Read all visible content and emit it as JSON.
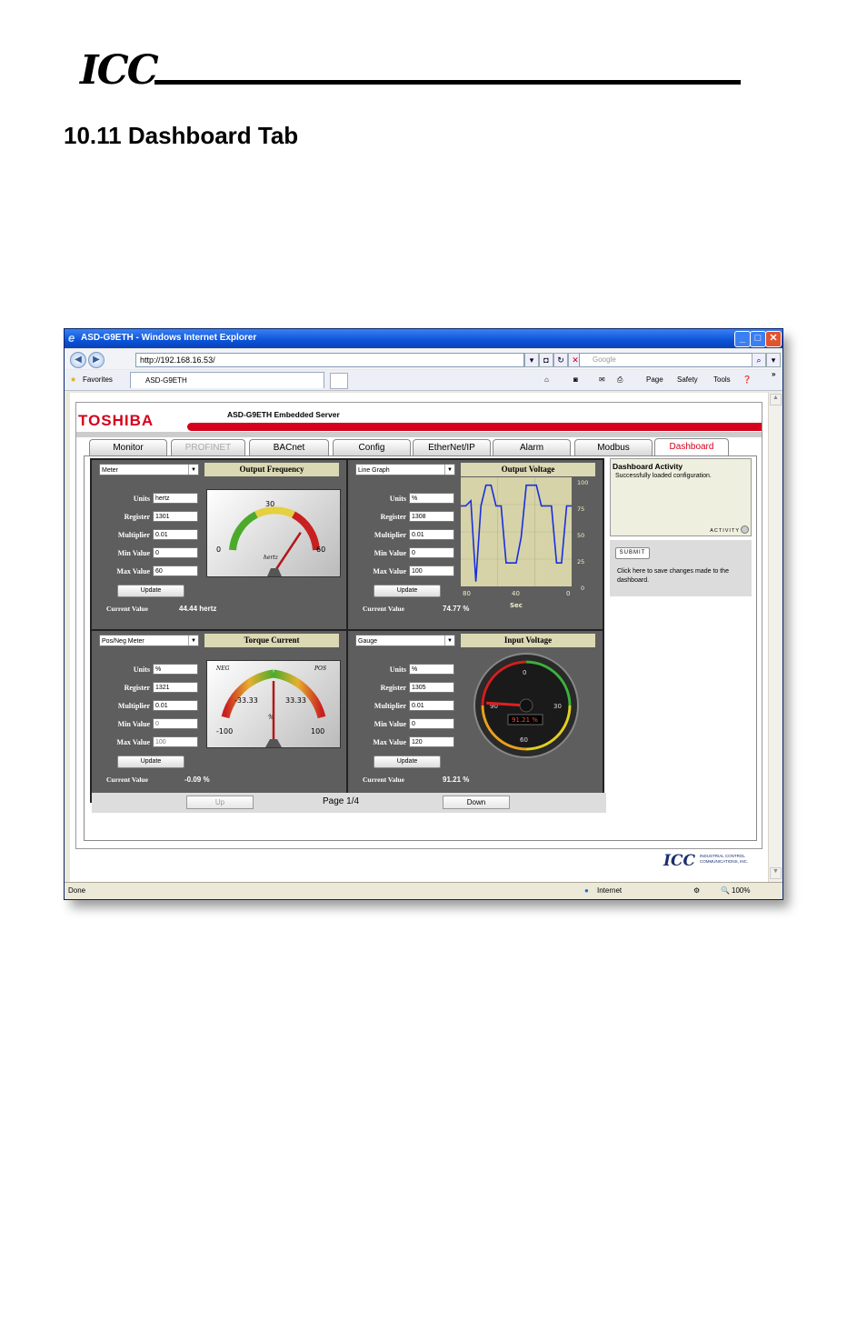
{
  "doc_header": {
    "logo": "ICC"
  },
  "section": {
    "title": "10.11   Dashboard Tab"
  },
  "window": {
    "title": "ASD-G9ETH - Windows Internet Explorer"
  },
  "browser": {
    "address": "http://192.168.16.53/",
    "search_placeholder": "Google",
    "favorites": "Favorites",
    "tab_title": "ASD-G9ETH",
    "menu": {
      "page": "Page",
      "safety": "Safety",
      "tools": "Tools"
    },
    "status_left": "Done",
    "status_zone": "Internet",
    "zoom": "100%"
  },
  "app": {
    "brand": "TOSHIBA",
    "server_title": "ASD-G9ETH Embedded Server",
    "tabs": [
      {
        "label": "Monitor",
        "state": "normal"
      },
      {
        "label": "PROFINET",
        "state": "disabled"
      },
      {
        "label": "BACnet",
        "state": "normal"
      },
      {
        "label": "Config",
        "state": "normal"
      },
      {
        "label": "EtherNet/IP",
        "state": "normal"
      },
      {
        "label": "Alarm",
        "state": "normal"
      },
      {
        "label": "Modbus",
        "state": "normal"
      },
      {
        "label": "Dashboard",
        "state": "active"
      }
    ],
    "field_labels": {
      "units": "Units",
      "register": "Register",
      "multiplier": "Multiplier",
      "min": "Min Value",
      "max": "Max Value",
      "update": "Update",
      "current": "Current Value"
    },
    "widgets": [
      {
        "type_select": "Meter",
        "title": "Output Frequency",
        "units": "hertz",
        "register": "1301",
        "multiplier": "0.01",
        "min": "0",
        "max": "60",
        "current": "44.44 hertz",
        "gauge": {
          "ticks": [
            "0",
            "30",
            "60"
          ],
          "unit_label": "hertz",
          "fraction": 0.74
        }
      },
      {
        "type_select": "Line Graph",
        "title": "Output Voltage",
        "units": "%",
        "register": "1308",
        "multiplier": "0.01",
        "min": "0",
        "max": "100",
        "current": "74.77 %",
        "chart_data": {
          "type": "line",
          "xlabel": "Sec",
          "x_ticks": [
            "80",
            "40",
            "0"
          ],
          "y_ticks": [
            "100",
            "75",
            "50",
            "25",
            "0"
          ],
          "ylim": [
            0,
            100
          ],
          "values": [
            75,
            75,
            80,
            2,
            75,
            95,
            95,
            75,
            75,
            20,
            20,
            20,
            45,
            95,
            95,
            95,
            75,
            75,
            75,
            20,
            20,
            75,
            75
          ]
        }
      },
      {
        "type_select": "Pos/Neg Meter",
        "title": "Torque Current",
        "units": "%",
        "register": "1321",
        "multiplier": "0.01",
        "min": "0",
        "max": "100",
        "current": "-0.09 %",
        "gauge": {
          "ticks": [
            "-100",
            "-33.33",
            "33.33",
            "100"
          ],
          "neg_label": "NEG",
          "pos_label": "POS",
          "unit_label": "%",
          "fraction": 0.5
        }
      },
      {
        "type_select": "Gauge",
        "title": "Input Voltage",
        "units": "%",
        "register": "1305",
        "multiplier": "0.01",
        "min": "0",
        "max": "120",
        "current": "91.21 %",
        "gauge": {
          "ticks": [
            "0",
            "30",
            "60",
            "90"
          ],
          "readout": "91.21 %",
          "fraction": 0.76
        }
      }
    ],
    "activity": {
      "title": "Dashboard Activity",
      "message": "Successfully loaded configuration.",
      "indicator": "ACTIVITY"
    },
    "submit": {
      "label": "SUBMIT",
      "help": "Click here to save changes made to the dashboard."
    },
    "pager": {
      "up": "Up",
      "label": "Page 1/4",
      "down": "Down"
    },
    "footer_logo": {
      "mark": "ICC",
      "text": "INDUSTRIAL CONTROL COMMUNICATIONS, INC."
    }
  }
}
